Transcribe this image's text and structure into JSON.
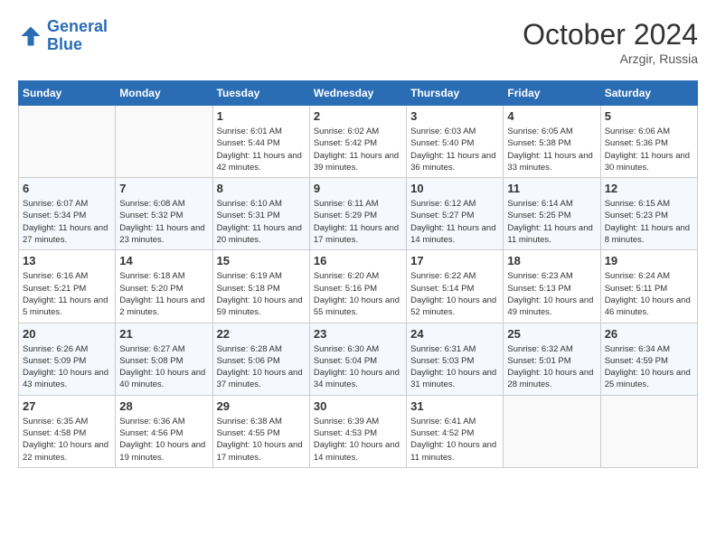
{
  "header": {
    "logo_line1": "General",
    "logo_line2": "Blue",
    "month": "October 2024",
    "location": "Arzgir, Russia"
  },
  "weekdays": [
    "Sunday",
    "Monday",
    "Tuesday",
    "Wednesday",
    "Thursday",
    "Friday",
    "Saturday"
  ],
  "weeks": [
    [
      {
        "day": "",
        "sunrise": "",
        "sunset": "",
        "daylight": "",
        "empty": true
      },
      {
        "day": "",
        "sunrise": "",
        "sunset": "",
        "daylight": "",
        "empty": true
      },
      {
        "day": "1",
        "sunrise": "Sunrise: 6:01 AM",
        "sunset": "Sunset: 5:44 PM",
        "daylight": "Daylight: 11 hours and 42 minutes."
      },
      {
        "day": "2",
        "sunrise": "Sunrise: 6:02 AM",
        "sunset": "Sunset: 5:42 PM",
        "daylight": "Daylight: 11 hours and 39 minutes."
      },
      {
        "day": "3",
        "sunrise": "Sunrise: 6:03 AM",
        "sunset": "Sunset: 5:40 PM",
        "daylight": "Daylight: 11 hours and 36 minutes."
      },
      {
        "day": "4",
        "sunrise": "Sunrise: 6:05 AM",
        "sunset": "Sunset: 5:38 PM",
        "daylight": "Daylight: 11 hours and 33 minutes."
      },
      {
        "day": "5",
        "sunrise": "Sunrise: 6:06 AM",
        "sunset": "Sunset: 5:36 PM",
        "daylight": "Daylight: 11 hours and 30 minutes."
      }
    ],
    [
      {
        "day": "6",
        "sunrise": "Sunrise: 6:07 AM",
        "sunset": "Sunset: 5:34 PM",
        "daylight": "Daylight: 11 hours and 27 minutes."
      },
      {
        "day": "7",
        "sunrise": "Sunrise: 6:08 AM",
        "sunset": "Sunset: 5:32 PM",
        "daylight": "Daylight: 11 hours and 23 minutes."
      },
      {
        "day": "8",
        "sunrise": "Sunrise: 6:10 AM",
        "sunset": "Sunset: 5:31 PM",
        "daylight": "Daylight: 11 hours and 20 minutes."
      },
      {
        "day": "9",
        "sunrise": "Sunrise: 6:11 AM",
        "sunset": "Sunset: 5:29 PM",
        "daylight": "Daylight: 11 hours and 17 minutes."
      },
      {
        "day": "10",
        "sunrise": "Sunrise: 6:12 AM",
        "sunset": "Sunset: 5:27 PM",
        "daylight": "Daylight: 11 hours and 14 minutes."
      },
      {
        "day": "11",
        "sunrise": "Sunrise: 6:14 AM",
        "sunset": "Sunset: 5:25 PM",
        "daylight": "Daylight: 11 hours and 11 minutes."
      },
      {
        "day": "12",
        "sunrise": "Sunrise: 6:15 AM",
        "sunset": "Sunset: 5:23 PM",
        "daylight": "Daylight: 11 hours and 8 minutes."
      }
    ],
    [
      {
        "day": "13",
        "sunrise": "Sunrise: 6:16 AM",
        "sunset": "Sunset: 5:21 PM",
        "daylight": "Daylight: 11 hours and 5 minutes."
      },
      {
        "day": "14",
        "sunrise": "Sunrise: 6:18 AM",
        "sunset": "Sunset: 5:20 PM",
        "daylight": "Daylight: 11 hours and 2 minutes."
      },
      {
        "day": "15",
        "sunrise": "Sunrise: 6:19 AM",
        "sunset": "Sunset: 5:18 PM",
        "daylight": "Daylight: 10 hours and 59 minutes."
      },
      {
        "day": "16",
        "sunrise": "Sunrise: 6:20 AM",
        "sunset": "Sunset: 5:16 PM",
        "daylight": "Daylight: 10 hours and 55 minutes."
      },
      {
        "day": "17",
        "sunrise": "Sunrise: 6:22 AM",
        "sunset": "Sunset: 5:14 PM",
        "daylight": "Daylight: 10 hours and 52 minutes."
      },
      {
        "day": "18",
        "sunrise": "Sunrise: 6:23 AM",
        "sunset": "Sunset: 5:13 PM",
        "daylight": "Daylight: 10 hours and 49 minutes."
      },
      {
        "day": "19",
        "sunrise": "Sunrise: 6:24 AM",
        "sunset": "Sunset: 5:11 PM",
        "daylight": "Daylight: 10 hours and 46 minutes."
      }
    ],
    [
      {
        "day": "20",
        "sunrise": "Sunrise: 6:26 AM",
        "sunset": "Sunset: 5:09 PM",
        "daylight": "Daylight: 10 hours and 43 minutes."
      },
      {
        "day": "21",
        "sunrise": "Sunrise: 6:27 AM",
        "sunset": "Sunset: 5:08 PM",
        "daylight": "Daylight: 10 hours and 40 minutes."
      },
      {
        "day": "22",
        "sunrise": "Sunrise: 6:28 AM",
        "sunset": "Sunset: 5:06 PM",
        "daylight": "Daylight: 10 hours and 37 minutes."
      },
      {
        "day": "23",
        "sunrise": "Sunrise: 6:30 AM",
        "sunset": "Sunset: 5:04 PM",
        "daylight": "Daylight: 10 hours and 34 minutes."
      },
      {
        "day": "24",
        "sunrise": "Sunrise: 6:31 AM",
        "sunset": "Sunset: 5:03 PM",
        "daylight": "Daylight: 10 hours and 31 minutes."
      },
      {
        "day": "25",
        "sunrise": "Sunrise: 6:32 AM",
        "sunset": "Sunset: 5:01 PM",
        "daylight": "Daylight: 10 hours and 28 minutes."
      },
      {
        "day": "26",
        "sunrise": "Sunrise: 6:34 AM",
        "sunset": "Sunset: 4:59 PM",
        "daylight": "Daylight: 10 hours and 25 minutes."
      }
    ],
    [
      {
        "day": "27",
        "sunrise": "Sunrise: 6:35 AM",
        "sunset": "Sunset: 4:58 PM",
        "daylight": "Daylight: 10 hours and 22 minutes."
      },
      {
        "day": "28",
        "sunrise": "Sunrise: 6:36 AM",
        "sunset": "Sunset: 4:56 PM",
        "daylight": "Daylight: 10 hours and 19 minutes."
      },
      {
        "day": "29",
        "sunrise": "Sunrise: 6:38 AM",
        "sunset": "Sunset: 4:55 PM",
        "daylight": "Daylight: 10 hours and 17 minutes."
      },
      {
        "day": "30",
        "sunrise": "Sunrise: 6:39 AM",
        "sunset": "Sunset: 4:53 PM",
        "daylight": "Daylight: 10 hours and 14 minutes."
      },
      {
        "day": "31",
        "sunrise": "Sunrise: 6:41 AM",
        "sunset": "Sunset: 4:52 PM",
        "daylight": "Daylight: 10 hours and 11 minutes."
      },
      {
        "day": "",
        "sunrise": "",
        "sunset": "",
        "daylight": "",
        "empty": true
      },
      {
        "day": "",
        "sunrise": "",
        "sunset": "",
        "daylight": "",
        "empty": true
      }
    ]
  ]
}
